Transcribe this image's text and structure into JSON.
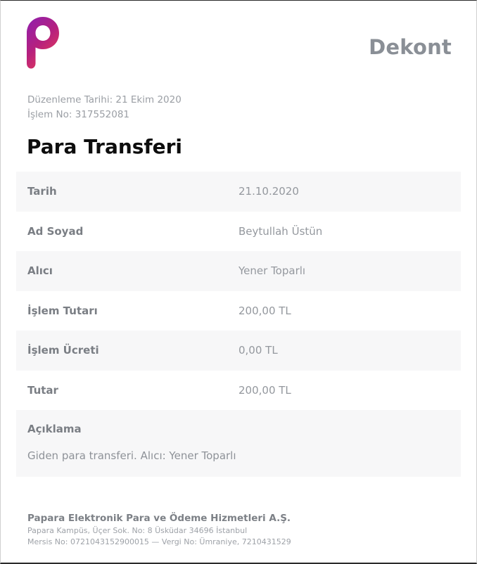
{
  "header": {
    "logo_icon": "papara-p-logo-icon",
    "doc_title": "Dekont"
  },
  "meta": {
    "date_line": "Düzenleme Tarihi: 21 Ekim 2020",
    "txn_line": "İşlem No: 317552081"
  },
  "title": "Para Transferi",
  "rows": [
    {
      "label": "Tarih",
      "value": "21.10.2020"
    },
    {
      "label": "Ad Soyad",
      "value": "Beytullah Üstün"
    },
    {
      "label": "Alıcı",
      "value": "Yener Toparlı"
    },
    {
      "label": "İşlem Tutarı",
      "value": "200,00 TL"
    },
    {
      "label": "İşlem Ücreti",
      "value": "0,00 TL"
    },
    {
      "label": "Tutar",
      "value": "200,00 TL"
    }
  ],
  "description": {
    "label": "Açıklama",
    "text": "Giden para transferi. Alıcı: Yener Toparlı"
  },
  "footer": {
    "company": "Papara Elektronik Para ve Ödeme Hizmetleri A.Ş.",
    "address": "Papara Kampüs, Üçer Sok. No: 8 Üsküdar 34696 İstanbul",
    "registry": "Mersis No: 0721043152900015 — Vergi No: Ümraniye, 7210431529"
  },
  "colors": {
    "logo_gradient_top": "#8e1fb0",
    "logo_gradient_bottom": "#e53a5a"
  }
}
